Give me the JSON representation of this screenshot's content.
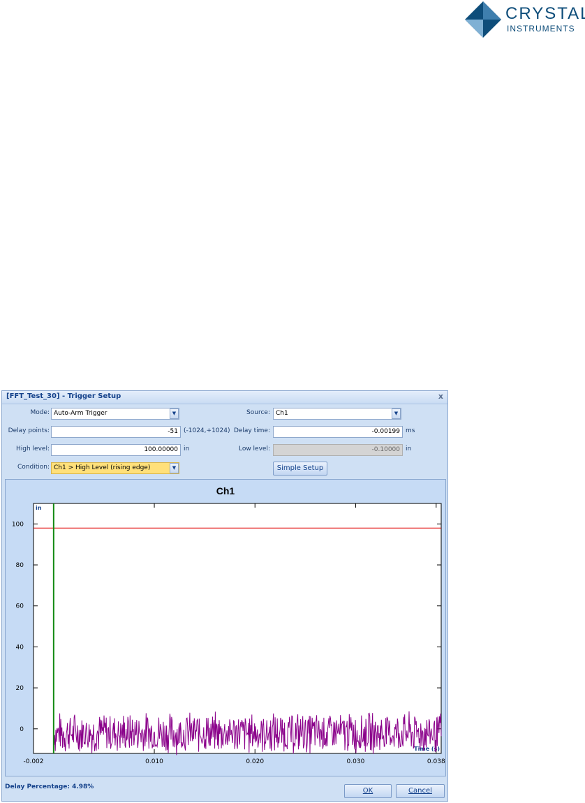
{
  "logo": {
    "line1": "CRYSTAL",
    "line2": "INSTRUMENTS"
  },
  "dialog": {
    "title": "[FFT_Test_30] - Trigger Setup",
    "close_label": "x",
    "mode": {
      "label": "Mode:",
      "value": "Auto-Arm Trigger"
    },
    "source": {
      "label": "Source:",
      "value": "Ch1"
    },
    "delay_points": {
      "label": "Delay points:",
      "value": "-51",
      "range": "(-1024,+1024)"
    },
    "delay_time": {
      "label": "Delay time:",
      "value": "-0.00199",
      "unit": "ms"
    },
    "high_level": {
      "label": "High level:",
      "value": "100.00000",
      "unit": "in"
    },
    "low_level": {
      "label": "Low level:",
      "value": "-0.10000",
      "unit": "in"
    },
    "condition": {
      "label": "Condition:",
      "value": "Ch1 > High Level (rising edge)"
    },
    "simple_setup_label": "Simple Setup",
    "delay_percentage": "Delay Percentage: 4.98%",
    "ok_label": "OK",
    "cancel_label": "Cancel"
  },
  "chart_data": {
    "type": "line",
    "title": "Ch1",
    "ylabel": "in",
    "xlabel": "Time (s)",
    "xlim": [
      -0.002,
      0.0385
    ],
    "ylim": [
      -12,
      110
    ],
    "x_ticks": [
      "-0.002",
      "0.010",
      "0.020",
      "0.030",
      "0.038"
    ],
    "x_tick_values": [
      -0.002,
      0.01,
      0.02,
      0.03,
      0.038
    ],
    "y_ticks": [
      "0",
      "20",
      "40",
      "60",
      "80",
      "100"
    ],
    "y_tick_values": [
      0,
      20,
      40,
      60,
      80,
      100
    ],
    "trigger_level_line": {
      "value": 98,
      "color": "#e00000"
    },
    "trigger_time_line": {
      "value": 0.0,
      "color": "#128a12"
    },
    "signal": {
      "name": "Ch1",
      "color": "#8a008a",
      "x_start": 0.0,
      "x_end": 0.0385,
      "baseline": -2,
      "peak_to_peak": 22
    }
  }
}
